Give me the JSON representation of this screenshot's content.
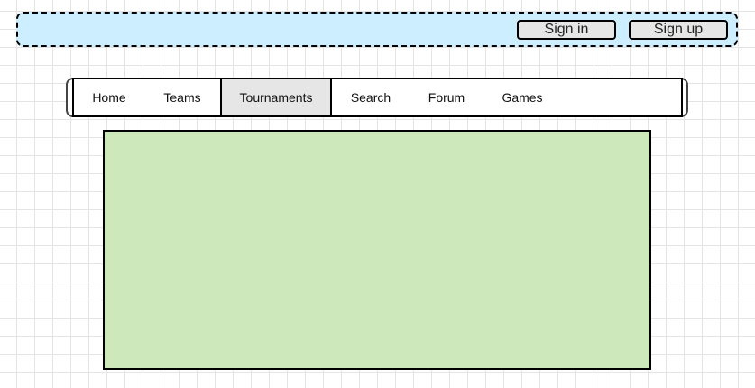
{
  "header": {
    "sign_in_label": "Sign in",
    "sign_up_label": "Sign up",
    "background_color": "#cceeff"
  },
  "nav": {
    "items": [
      {
        "label": "Home"
      },
      {
        "label": "Teams"
      },
      {
        "label": "Tournaments",
        "active": true
      },
      {
        "label": "Search"
      },
      {
        "label": "Forum"
      },
      {
        "label": "Games"
      }
    ],
    "active_color": "#e6e6e6"
  },
  "content": {
    "background_color": "#cde8bb"
  }
}
